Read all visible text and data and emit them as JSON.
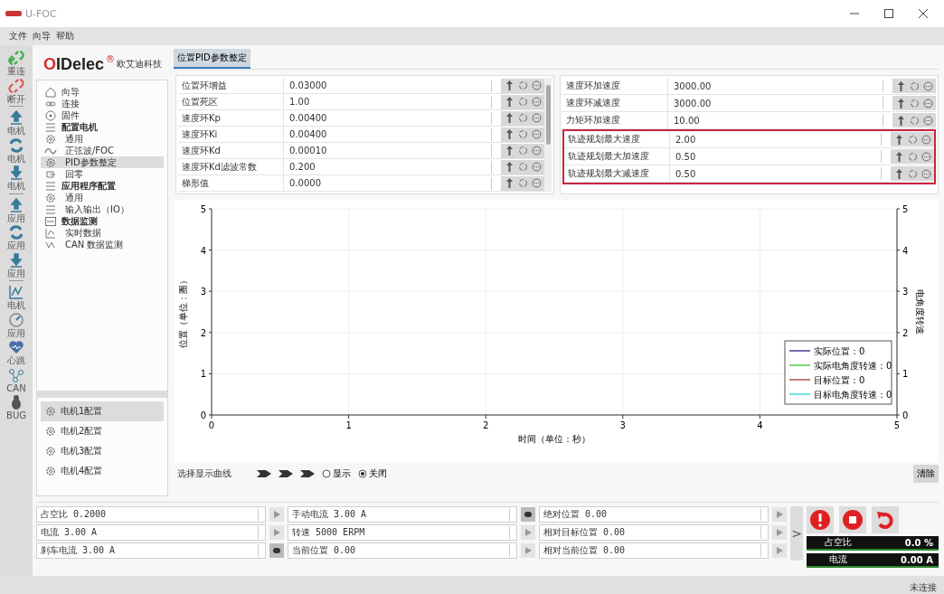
{
  "window": {
    "title": "U-FOC"
  },
  "menu": [
    "文件",
    "向导",
    "帮助"
  ],
  "toolbar": [
    {
      "kind": "link",
      "label": "重连"
    },
    {
      "kind": "unlink",
      "label": "断开"
    },
    {
      "kind": "sep"
    },
    {
      "kind": "upload",
      "label": "电机"
    },
    {
      "kind": "refresh",
      "label": "电机"
    },
    {
      "kind": "download",
      "label": "电机"
    },
    {
      "kind": "sep"
    },
    {
      "kind": "upload",
      "label": "应用"
    },
    {
      "kind": "refresh",
      "label": "应用"
    },
    {
      "kind": "download",
      "label": "应用"
    },
    {
      "kind": "sep"
    },
    {
      "kind": "scope",
      "label": "电机"
    },
    {
      "kind": "gauge",
      "label": "应用"
    },
    {
      "kind": "heart",
      "label": "心跳"
    },
    {
      "kind": "can",
      "label": "CAN"
    },
    {
      "kind": "bug",
      "label": "BUG"
    }
  ],
  "brand": {
    "name": "OIDelec",
    "mark": "®",
    "subtitle": "欧艾迪科技"
  },
  "nav": [
    {
      "label": "向导",
      "kind": "home",
      "selected": false
    },
    {
      "label": "连接",
      "kind": "link",
      "selected": false
    },
    {
      "label": "固件",
      "kind": "chip",
      "selected": false
    },
    {
      "label": "配置电机",
      "kind": "list",
      "selected": false,
      "children": [
        {
          "label": "通用",
          "kind": "gear",
          "selected": false
        },
        {
          "label": "正弦波/FOC",
          "kind": "wave",
          "selected": false
        },
        {
          "label": "PID参数整定",
          "kind": "gear",
          "selected": true
        },
        {
          "label": "回零",
          "kind": "home0",
          "selected": false
        }
      ]
    },
    {
      "label": "应用程序配置",
      "kind": "list",
      "selected": false,
      "children": [
        {
          "label": "通用",
          "kind": "gear",
          "selected": false
        },
        {
          "label": "输入输出（IO）",
          "kind": "io",
          "selected": false
        }
      ]
    },
    {
      "label": "数据监测",
      "kind": "monitor",
      "selected": false,
      "children": [
        {
          "label": "实时数据",
          "kind": "scope",
          "selected": false
        },
        {
          "label": "CAN 数据监测",
          "kind": "can",
          "selected": false
        }
      ]
    }
  ],
  "motors": [
    {
      "label": "电机1配置",
      "selected": true
    },
    {
      "label": "电机2配置",
      "selected": false
    },
    {
      "label": "电机3配置",
      "selected": false
    },
    {
      "label": "电机4配置",
      "selected": false
    }
  ],
  "tabs": [
    {
      "label": "位置PID参数整定",
      "selected": true
    }
  ],
  "params_left": [
    {
      "name": "位置环增益",
      "value": "0.03000",
      "highlighted": false
    },
    {
      "name": "位置死区",
      "value": "1.00",
      "highlighted": false
    },
    {
      "name": "速度环Kp",
      "value": "0.00400",
      "highlighted": false
    },
    {
      "name": "速度环Ki",
      "value": "0.00400",
      "highlighted": false
    },
    {
      "name": "速度环Kd",
      "value": "0.00010",
      "highlighted": false
    },
    {
      "name": "速度环Kd滤波常数",
      "value": "0.200",
      "highlighted": false
    },
    {
      "name": "梯形值",
      "value": "0.0000",
      "highlighted": false
    }
  ],
  "params_right": [
    {
      "name": "速度环加速度",
      "value": "3000.00",
      "highlighted": false
    },
    {
      "name": "速度环减速度",
      "value": "3000.00",
      "highlighted": false
    },
    {
      "name": "力矩环加速度",
      "value": "10.00",
      "highlighted": false
    },
    {
      "name": "轨迹规划最大速度",
      "value": "2.00",
      "highlighted": true
    },
    {
      "name": "轨迹规划最大加速度",
      "value": "0.50",
      "highlighted": true
    },
    {
      "name": "轨迹规划最大减速度",
      "value": "0.50",
      "highlighted": true
    }
  ],
  "chart": {
    "chart_data": {
      "type": "line",
      "xlabel": "时间（单位：秒）",
      "ylabel": "位置（单位：圈）",
      "y2label": "电角度转速",
      "categories": [
        "0",
        "1",
        "2",
        "3",
        "4",
        "5"
      ],
      "ylim": [
        0,
        5
      ],
      "yticks": [
        0,
        1,
        2,
        3,
        4,
        5
      ],
      "y2lim": [
        0,
        5
      ],
      "y2ticks": [
        0,
        1,
        2,
        3,
        4,
        5
      ],
      "grid": true,
      "series": [
        {
          "name": "实际位置：0",
          "color": "#3b3b9a",
          "values": [
            null,
            null,
            null,
            null,
            null,
            null
          ]
        },
        {
          "name": "实际电角度转速：0",
          "color": "#44cc44",
          "values": [
            null,
            null,
            null,
            null,
            null,
            null
          ]
        },
        {
          "name": "目标位置：0",
          "color": "#b84a4a",
          "values": [
            null,
            null,
            null,
            null,
            null,
            null
          ]
        },
        {
          "name": "目标电角度转速：0",
          "color": "#44d8d8",
          "values": [
            null,
            null,
            null,
            null,
            null,
            null
          ]
        }
      ]
    }
  },
  "curve_select": {
    "label": "选择显示曲线",
    "options": [
      {
        "label": "显示",
        "selected": false
      },
      {
        "label": "关闭",
        "selected": true
      }
    ],
    "clear_button": "清除"
  },
  "controls": [
    [
      {
        "text": "占空比 0.2000",
        "active": false
      },
      {
        "text": "电流 3.00 A",
        "active": false
      },
      {
        "text": "刹车电流 3.00 A",
        "active": true
      }
    ],
    [
      {
        "text": "手动电流 3.00 A",
        "active": true
      },
      {
        "text": "转速 5000 ERPM",
        "active": false
      },
      {
        "text": "当前位置 0.00",
        "active": false
      }
    ],
    [
      {
        "text": "绝对位置 0.00",
        "active": false
      },
      {
        "text": "相对目标位置 0.00",
        "active": false
      },
      {
        "text": "相对当前位置 0.00",
        "active": false
      }
    ]
  ],
  "expand_button": ">",
  "readouts": [
    {
      "label": "占空比",
      "value": "0.0 %"
    },
    {
      "label": "电流",
      "value": "0.00 A"
    }
  ],
  "status_bar": {
    "text": "未连接"
  }
}
